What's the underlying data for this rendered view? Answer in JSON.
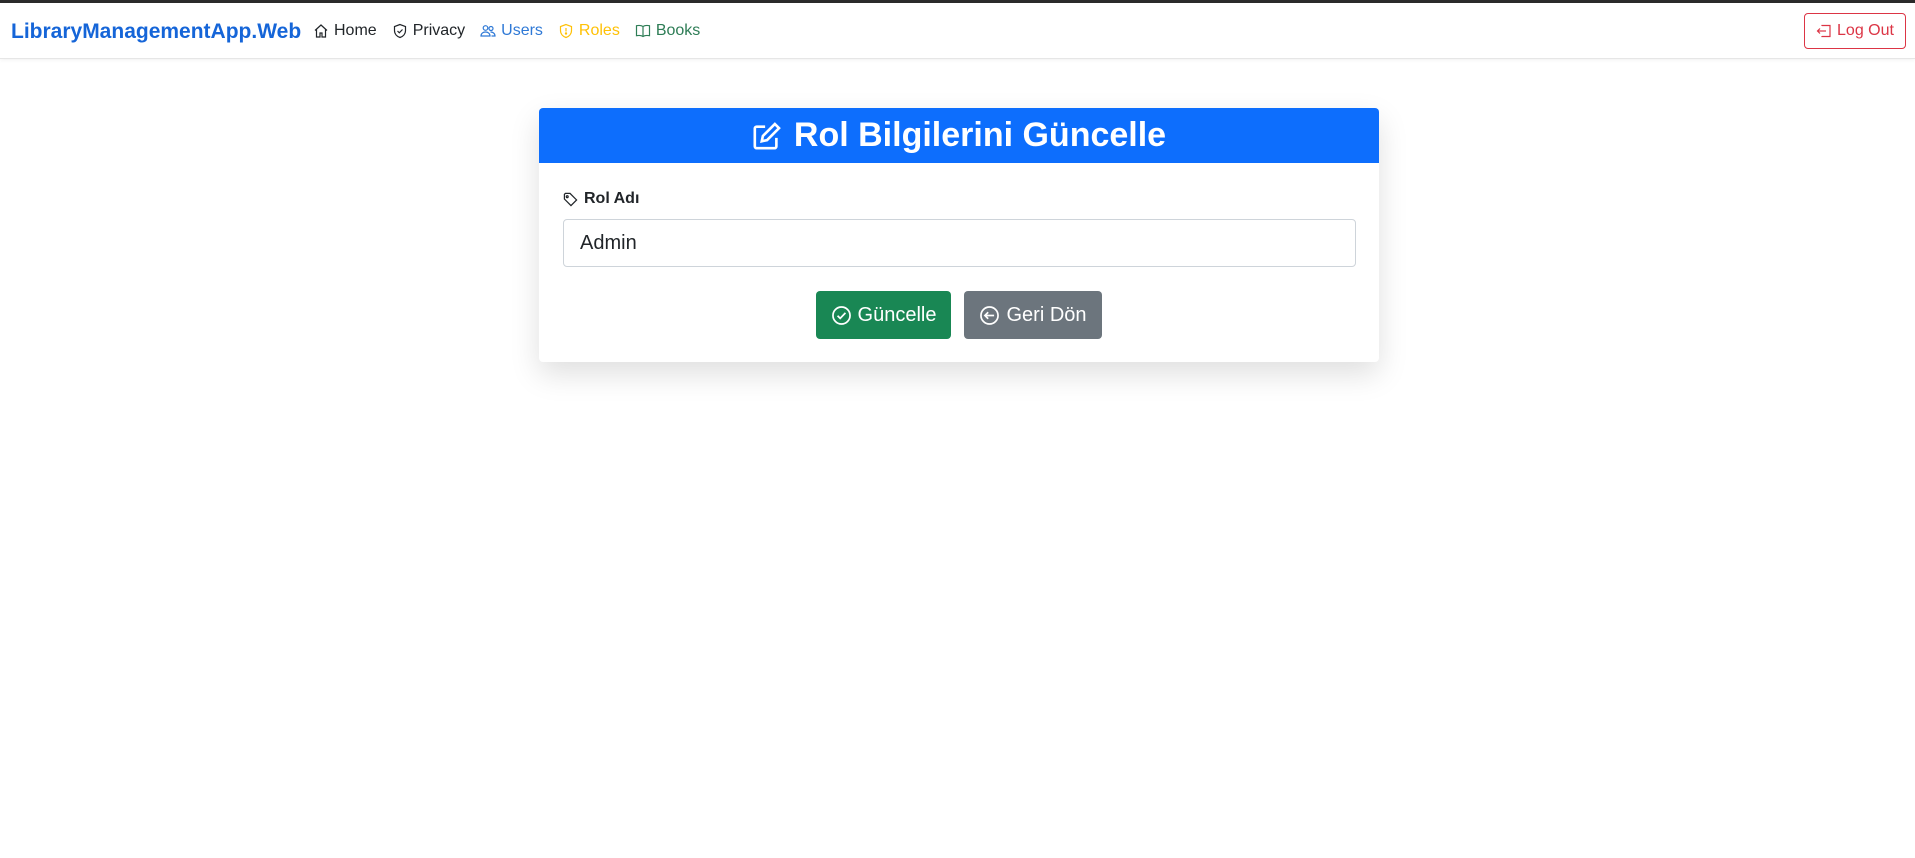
{
  "brand": "LibraryManagementApp.Web",
  "nav": {
    "home": "Home",
    "privacy": "Privacy",
    "users": "Users",
    "roles": "Roles",
    "books": "Books",
    "logout": "Log Out"
  },
  "colors": {
    "brand": "#1565d8",
    "header": "#0d6efd",
    "update_button": "#198754",
    "back_button": "#6c757d",
    "logout": "#dc3545",
    "roles_link": "#ffc107",
    "users_link": "#2f79d6",
    "books_link": "#2e7d56"
  },
  "icons": {
    "home": "house-icon",
    "privacy": "shield-icon",
    "users": "people-icon",
    "roles": "shield-exclamation-icon",
    "books": "book-icon",
    "logout": "box-arrow-left-icon",
    "title": "pencil-square-icon",
    "label": "tag-icon",
    "update": "check-circle-icon",
    "back": "arrow-left-circle-icon"
  },
  "card": {
    "title": "Rol Bilgilerini Güncelle",
    "label": "Rol Adı",
    "role_name_value": "Admin",
    "update_label": "Güncelle",
    "back_label": "Geri Dön"
  }
}
